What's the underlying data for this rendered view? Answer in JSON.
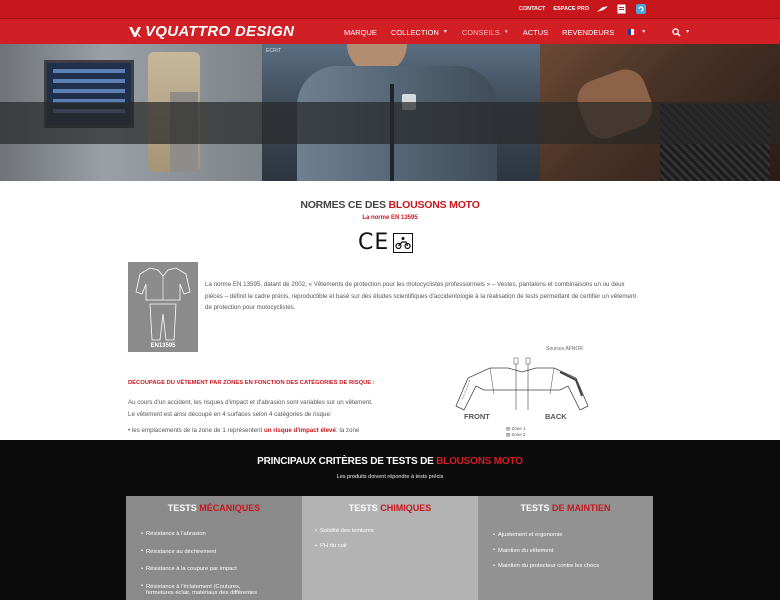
{
  "topbar": {
    "contact": "CONTACT",
    "pro": "ESPACE PRO"
  },
  "nav": {
    "logo": "VQUATTRO DESIGN",
    "items": [
      "MARQUE",
      "COLLECTION",
      "CONSEILS",
      "ACTUS",
      "REVENDEURS"
    ]
  },
  "hero": {
    "crumb": "ECRIT"
  },
  "content": {
    "title_a": "NORMES CE DES ",
    "title_b": "BLOUSONS MOTO",
    "subtitle": "La norme EN 13595",
    "ce_letters": "CE",
    "thumb_label": "EN13595",
    "intro": "La norme EN 13595, datant de 2002, « Vêtements de protection pour les motocyclistes professionnels » – Vestes, pantalons et combinaisons un ou deux pièces – définit le cadre précis, reproductible et basé sur des études scientifiques d'accidentologie à la réalisation de tests permettant de certifier un vêtement de protection pour motocyclistes.",
    "section_head": "DÉCOUPAGE DU VÊTEMENT PAR ZONES EN FONCTION DES CATÉGORIES DE RISQUE :",
    "para": "Au cours d'un accident, les risques d'impact et d'abrasion sont variables sur un vêtement. Le vêtement est ainsi découpé en 4 surfaces selon 4 catégories de risque:",
    "bullet_a": "• les emplacements de la zone de 1 représentent ",
    "bullet_b": "un risque d'impact élevé",
    "bullet_c": ": la zone",
    "diagram": {
      "source": "Sources AFNOR",
      "front": "FRONT",
      "back": "BACK",
      "zone1": "Zone 1",
      "zone2": "Zone 2"
    }
  },
  "dark": {
    "title_a": "PRINCIPAUX CRITÈRES DE TESTS DE ",
    "title_b": "BLOUSONS MOTO",
    "subtitle": "Les produits doivent répondre à tests précis",
    "cols": [
      {
        "title_a": "TESTS ",
        "title_b": "MÉCANIQUES",
        "items": [
          "Résistance à l'abrasion",
          "Résistance au déchirement",
          "Résistance à la coupure par impact",
          "Résistance à l'éclatement (Coutures,",
          "fermetures éclair, matériaux des différentes"
        ]
      },
      {
        "title_a": "TESTS ",
        "title_b": "CHIMIQUES",
        "items": [
          "Solidité des teintures",
          "PH du cuir"
        ]
      },
      {
        "title_a": "TESTS",
        "title_b": " DE MAINTIEN",
        "items": [
          "Ajustement et ergonomie",
          "Maintien du vêtement",
          "Maintien du protecteur contre les chocs"
        ]
      }
    ]
  },
  "colors": {
    "brand_red": "#c8161d",
    "nav_red": "#d21e25",
    "dark_bg": "#0b0b0b"
  }
}
